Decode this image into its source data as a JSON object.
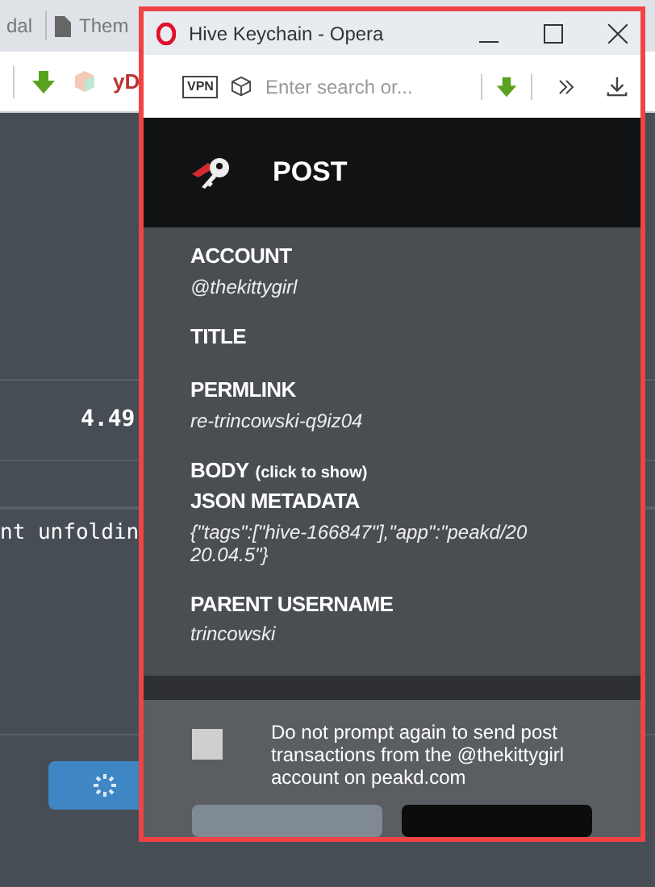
{
  "background_browser": {
    "tabs": [
      {
        "label": "dal"
      },
      {
        "label": "Them"
      }
    ],
    "toolbar_text": "yD",
    "page": {
      "amount": "4.49",
      "code_text": "nt unfoldin"
    }
  },
  "window": {
    "title": "Hive Keychain - Opera",
    "address_bar": {
      "vpn_badge": "VPN",
      "placeholder": "Enter search or..."
    }
  },
  "header": {
    "title": "POST"
  },
  "fields": [
    {
      "label": "ACCOUNT",
      "value": "@thekittygirl"
    },
    {
      "label": "TITLE"
    },
    {
      "label": "PERMLINK",
      "value": "re-trincowski-q9iz04"
    },
    {
      "label": "BODY",
      "hint": "(click to show)"
    },
    {
      "label": "JSON METADATA",
      "value": "{\"tags\":[\"hive-166847\"],\"app\":\"peakd/2020.04.5\"}"
    },
    {
      "label": "PARENT USERNAME",
      "value": "trincowski"
    }
  ],
  "no_prompt": {
    "checked": false,
    "text": "Do not prompt again to send post transactions from the @thekittygirl account on peakd.com"
  }
}
